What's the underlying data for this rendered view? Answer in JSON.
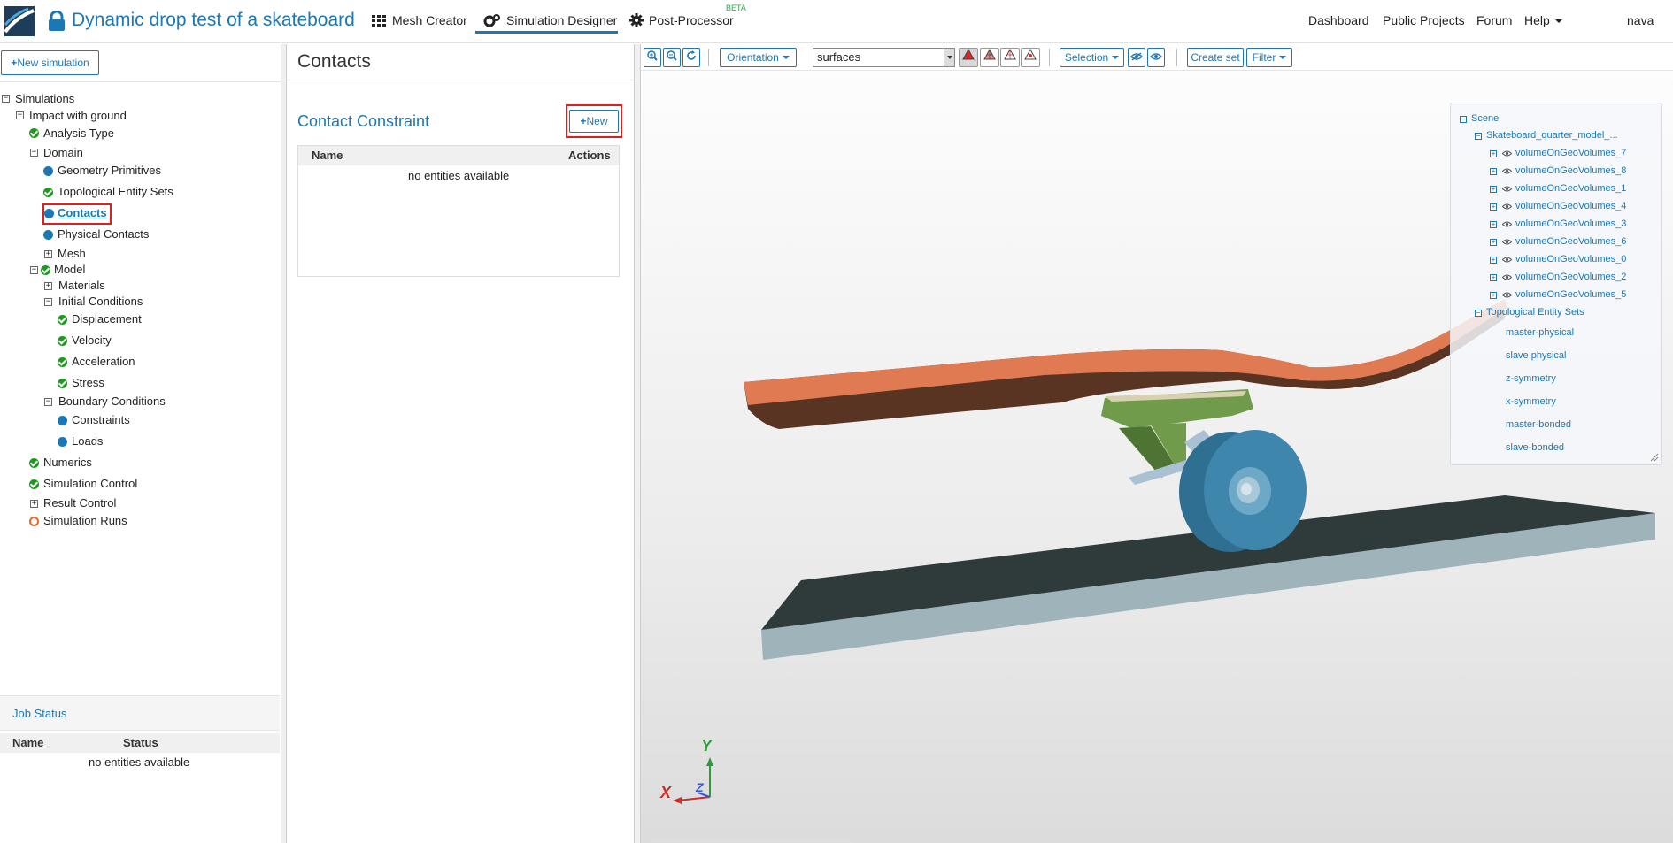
{
  "header": {
    "project_title": "Dynamic drop test of a skateboard",
    "tabs": [
      {
        "label": "Mesh Creator"
      },
      {
        "label": "Simulation Designer"
      },
      {
        "label": "Post-Processor",
        "badge": "BETA"
      }
    ],
    "links": [
      "Dashboard",
      "Public Projects",
      "Forum",
      "Help"
    ],
    "user": "nava"
  },
  "sidebar": {
    "new_simulation_label": "New simulation",
    "tree": {
      "simulations": "Simulations",
      "impact": "Impact with ground",
      "analysis_type": "Analysis Type",
      "domain": "Domain",
      "geometry_primitives": "Geometry Primitives",
      "topological_entity_sets": "Topological Entity Sets",
      "contacts": "Contacts",
      "physical_contacts": "Physical Contacts",
      "mesh": "Mesh",
      "model": "Model",
      "materials": "Materials",
      "initial_conditions": "Initial Conditions",
      "displacement": "Displacement",
      "velocity": "Velocity",
      "acceleration": "Acceleration",
      "stress": "Stress",
      "boundary_conditions": "Boundary Conditions",
      "constraints": "Constraints",
      "loads": "Loads",
      "numerics": "Numerics",
      "simulation_control": "Simulation Control",
      "result_control": "Result Control",
      "simulation_runs": "Simulation Runs"
    }
  },
  "job_status": {
    "title": "Job Status",
    "columns": [
      "Name",
      "Status"
    ],
    "empty": "no entities available"
  },
  "contacts_panel": {
    "title": "Contacts",
    "section_title": "Contact Constraint",
    "new_label": "New",
    "columns": [
      "Name",
      "Actions"
    ],
    "empty": "no entities available"
  },
  "toolbar": {
    "orientation": "Orientation",
    "render_mode": "surfaces",
    "selection": "Selection",
    "create_set": "Create set",
    "filter": "Filter"
  },
  "scene_tree": {
    "root": "Scene",
    "model": "Skateboard_quarter_model_...",
    "volumes": [
      "volumeOnGeoVolumes_7",
      "volumeOnGeoVolumes_8",
      "volumeOnGeoVolumes_1",
      "volumeOnGeoVolumes_4",
      "volumeOnGeoVolumes_3",
      "volumeOnGeoVolumes_6",
      "volumeOnGeoVolumes_0",
      "volumeOnGeoVolumes_2",
      "volumeOnGeoVolumes_5"
    ],
    "sets_label": "Topological Entity Sets",
    "sets": [
      "master-physical",
      "slave physical",
      "z-symmetry",
      "x-symmetry",
      "master-bonded",
      "slave-bonded"
    ]
  },
  "axes": {
    "x": "X",
    "y": "Y",
    "z": "Z"
  },
  "colors": {
    "accent": "#1b78b4",
    "ok": "#1e9a1e",
    "highlight": "#e01e1e",
    "deck_top": "#e07a52",
    "deck_side": "#5a3423",
    "truck": "#6f9b4a",
    "wheel": "#3f86ad",
    "ground_top": "#2f3b3b",
    "ground_side": "#9fb3ba"
  }
}
